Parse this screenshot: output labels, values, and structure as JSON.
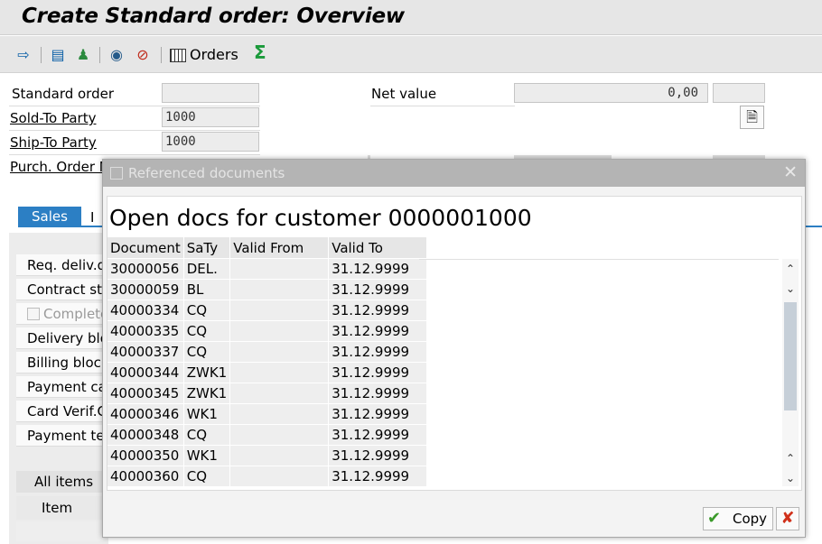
{
  "window": {
    "title": "Create Standard order: Overview"
  },
  "toolbar": {
    "orders_label": "Orders",
    "icons": [
      "display-document-icon",
      "copy-document-icon",
      "person-icon",
      "binoculars-icon",
      "delete-search-icon",
      "orders-grid-icon",
      "sum-icon"
    ]
  },
  "header": {
    "standard_order_label": "Standard order",
    "standard_order_value": "",
    "net_value_label": "Net value",
    "net_value_value": "0,00",
    "currency_value": "",
    "sold_to_label": "Sold-To Party",
    "sold_to_value": "1000",
    "ship_to_label": "Ship-To Party",
    "ship_to_value": "1000",
    "purch_order_label": "Purch. Order N"
  },
  "tabs": {
    "sales": "Sales",
    "next_visible": "I"
  },
  "sales_fields": [
    {
      "label": "Req. deliv.d"
    },
    {
      "label": "Contract sta"
    },
    {
      "label": "Complete"
    },
    {
      "label": "Delivery blo"
    },
    {
      "label": "Billing block"
    },
    {
      "label": "Payment ca"
    },
    {
      "label": "Card Verif.C"
    },
    {
      "label": "Payment ter"
    }
  ],
  "items": {
    "tab_label": "All items",
    "column_item": "Item"
  },
  "dialog": {
    "title": "Referenced documents",
    "heading": "Open docs for customer 0000001000",
    "columns": [
      "Document",
      "SaTy",
      "Valid From",
      "Valid To"
    ],
    "rows": [
      [
        "30000056",
        "DEL.",
        "",
        "31.12.9999"
      ],
      [
        "30000059",
        "BL",
        "",
        "31.12.9999"
      ],
      [
        "40000334",
        "CQ",
        "",
        "31.12.9999"
      ],
      [
        "40000335",
        "CQ",
        "",
        "31.12.9999"
      ],
      [
        "40000337",
        "CQ",
        "",
        "31.12.9999"
      ],
      [
        "40000344",
        "ZWK1",
        "",
        "31.12.9999"
      ],
      [
        "40000345",
        "ZWK1",
        "",
        "31.12.9999"
      ],
      [
        "40000346",
        "WK1",
        "",
        "31.12.9999"
      ],
      [
        "40000348",
        "CQ",
        "",
        "31.12.9999"
      ],
      [
        "40000350",
        "WK1",
        "",
        "31.12.9999"
      ],
      [
        "40000360",
        "CQ",
        "",
        "31.12.9999"
      ]
    ],
    "copy_label": "Copy"
  }
}
